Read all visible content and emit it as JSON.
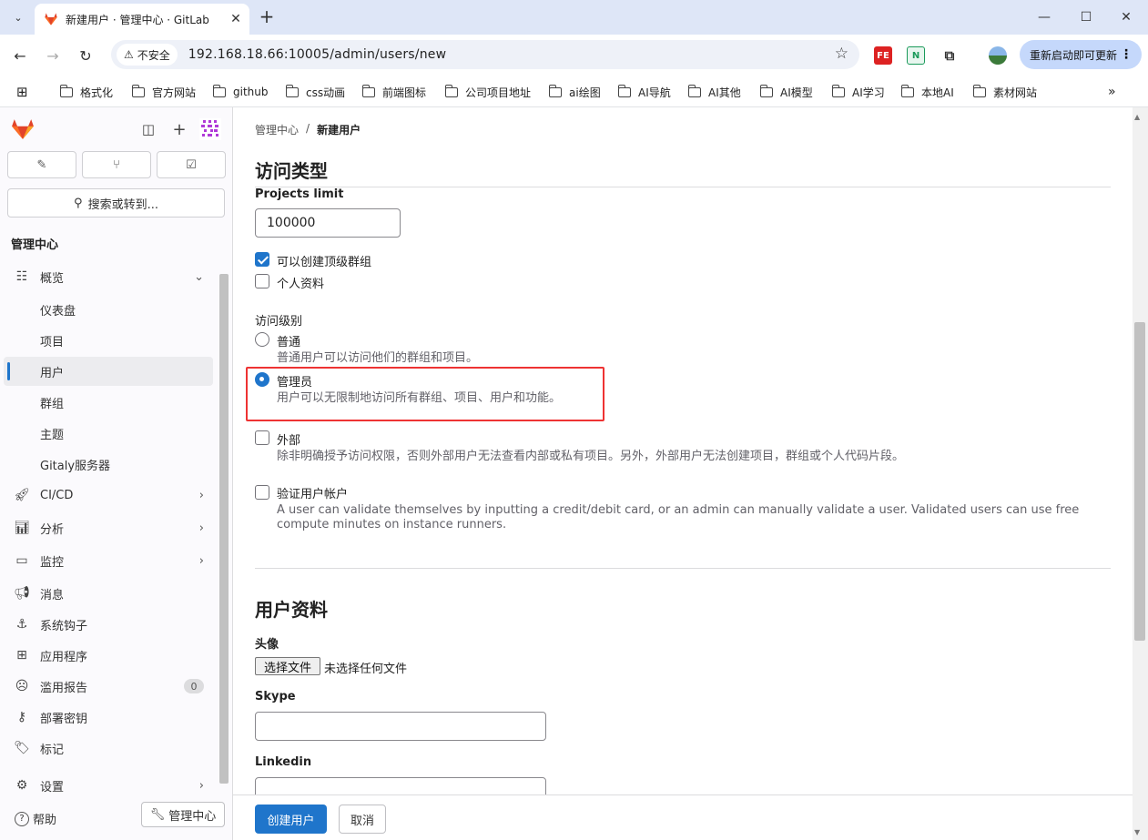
{
  "browser": {
    "tab_title": "新建用户 · 管理中心 · GitLab",
    "security_label": "不安全",
    "url": "192.168.18.66:10005/admin/users/new",
    "update_button": "重新启动即可更新",
    "bookmarks": [
      "格式化",
      "官方网站",
      "github",
      "css动画",
      "前端图标",
      "公司项目地址",
      "ai绘图",
      "AI导航",
      "AI其他",
      "AI模型",
      "AI学习",
      "本地AI",
      "素材网站"
    ],
    "ext_fe": "FE",
    "ext_n": "N"
  },
  "sidebar": {
    "search_placeholder": "搜索或转到...",
    "section_title": "管理中心",
    "overview_label": "概览",
    "sub_items": [
      "仪表盘",
      "项目",
      "用户",
      "群组",
      "主题",
      "Gitaly服务器"
    ],
    "items": [
      {
        "label": "CI/CD",
        "icon": "rocket-icon"
      },
      {
        "label": "分析",
        "icon": "chart-icon"
      },
      {
        "label": "监控",
        "icon": "monitor-icon"
      },
      {
        "label": "消息",
        "icon": "megaphone-icon"
      },
      {
        "label": "系统钩子",
        "icon": "anchor-icon"
      },
      {
        "label": "应用程序",
        "icon": "apps-icon"
      },
      {
        "label": "滥用报告",
        "icon": "emoji-icon",
        "badge": "0"
      },
      {
        "label": "部署密钥",
        "icon": "key-icon"
      },
      {
        "label": "标记",
        "icon": "label-icon"
      }
    ],
    "settings_label": "设置",
    "help_label": "帮助",
    "admin_button": "管理中心"
  },
  "breadcrumb": {
    "parent": "管理中心",
    "current": "新建用户"
  },
  "access": {
    "heading": "访问类型",
    "projects_limit_label": "Projects limit",
    "projects_limit_value": "100000",
    "can_create_group_label": "可以创建顶级群组",
    "can_create_group_checked": true,
    "private_profile_label": "个人资料",
    "private_profile_checked": false,
    "level_label": "访问级别",
    "regular_label": "普通",
    "regular_help": "普通用户可以访问他们的群组和项目。",
    "admin_label": "管理员",
    "admin_help": "用户可以无限制地访问所有群组、项目、用户和功能。",
    "selected_level": "管理员",
    "external_label": "外部",
    "external_help": "除非明确授予访问权限，否则外部用户无法查看内部或私有项目。另外，外部用户无法创建项目，群组或个人代码片段。",
    "validate_label": "验证用户帐户",
    "validate_help_1": "A user can validate themselves by inputting a credit/debit card, or an admin can manually validate a user. Validated users can use free",
    "validate_help_2": "compute minutes on instance runners."
  },
  "profile": {
    "heading": "用户资料",
    "avatar_label": "头像",
    "file_button": "选择文件",
    "file_status": "未选择任何文件",
    "skype_label": "Skype",
    "linkedin_label": "Linkedin"
  },
  "footer": {
    "create_button": "创建用户",
    "cancel_button": "取消"
  },
  "colors": {
    "accent": "#1f75cb",
    "highlight": "#e33333"
  }
}
